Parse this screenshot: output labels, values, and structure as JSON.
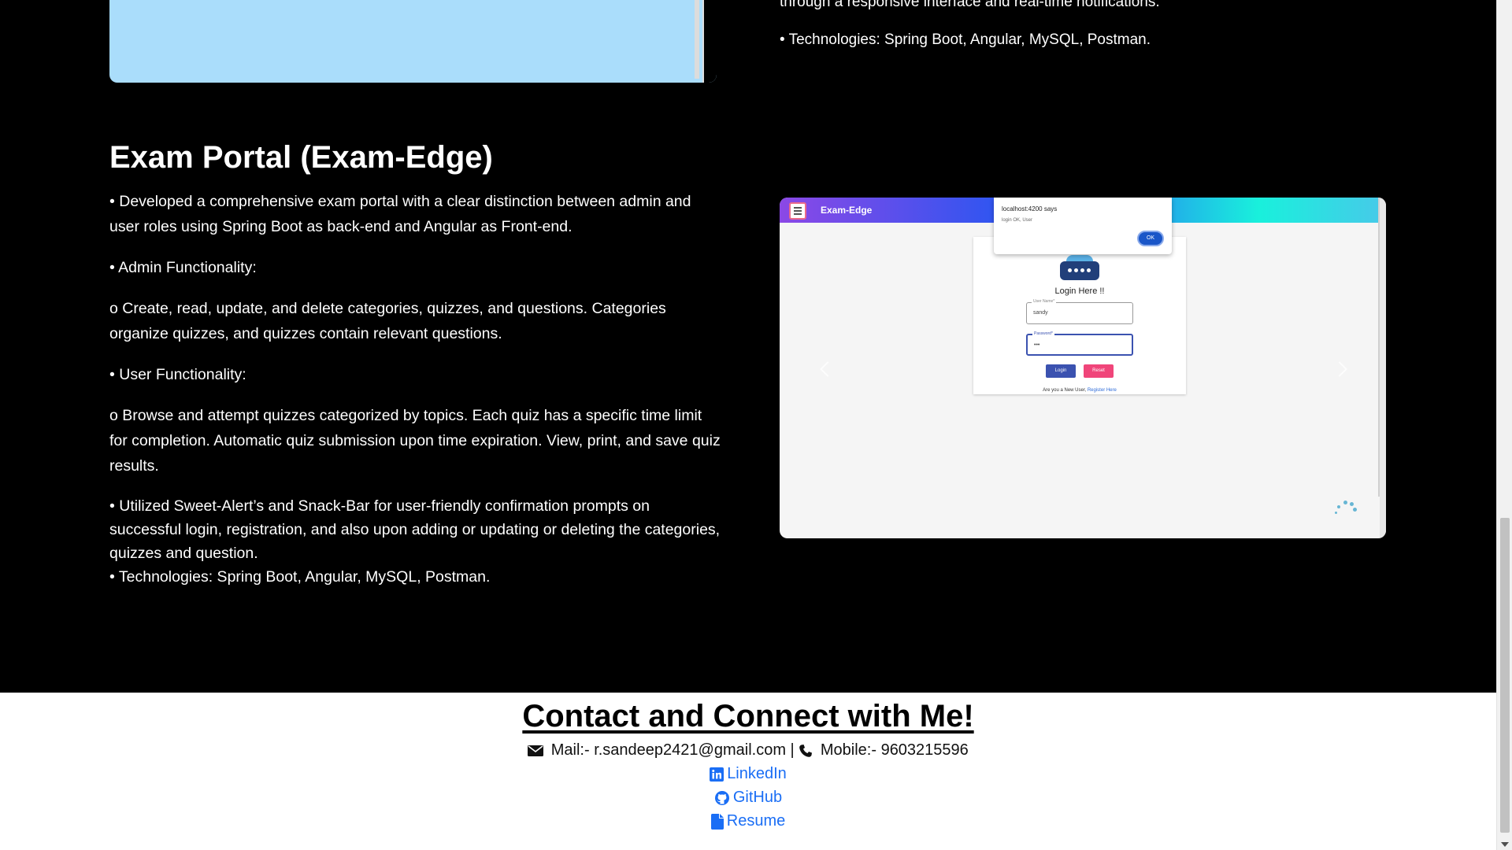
{
  "top_project": {
    "partial_line": "through a responsive interface and real-time notifications.",
    "technologies": "• Technologies: Spring Boot, Angular, MySQL, Postman."
  },
  "exam_project": {
    "title": "Exam Portal (Exam-Edge)",
    "paragraphs": [
      "• Developed a comprehensive exam portal with a clear distinction between admin and user roles using Spring Boot as back-end and Angular as Front-end.",
      "• Admin Functionality:",
      "o Create, read, update, and delete categories, quizzes, and questions. Categories organize quizzes, and quizzes contain relevant questions.",
      "• User Functionality:",
      "o Browse and attempt quizzes categorized by topics. Each quiz has a specific time limit for completion. Automatic quiz submission upon time expiration. View, print, and save quiz results.",
      "• Utilized Sweet-Alert’s and Snack-Bar for user-friendly confirmation prompts on successful login, registration, and also upon adding or updating or deleting the categories, quizzes and question.",
      "• Technologies: Spring Boot, Angular, MySQL, Postman."
    ],
    "screenshot": {
      "app_name": "Exam-Edge",
      "alert_title": "localhost:4200 says",
      "alert_message": "login OK, User",
      "alert_ok": "OK",
      "login_heading": "Login Here !!",
      "username_label": "User Name*",
      "username_value": "sandy",
      "password_label": "Password*",
      "password_value": "•••",
      "login_button": "Login",
      "reset_button": "Reset",
      "register_prompt": "Are you a New User,",
      "register_link": "Register Here"
    }
  },
  "footer": {
    "title": "Contact and Connect with Me!",
    "mail_label": "Mail:- r.sandeep2421@gmail.com",
    "separator": "|",
    "mobile_label": "Mobile:- 9603215596",
    "linkedin": "LinkedIn",
    "github": "GitHub",
    "resume": "Resume"
  },
  "colors": {
    "background": "#000000",
    "link": "#1a6ef5",
    "footer_bg": "#ffffff"
  }
}
